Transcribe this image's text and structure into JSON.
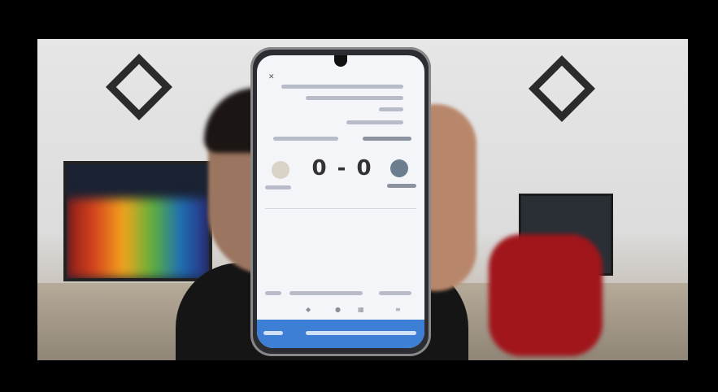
{
  "phone_screen": {
    "score": "0 - 0"
  }
}
